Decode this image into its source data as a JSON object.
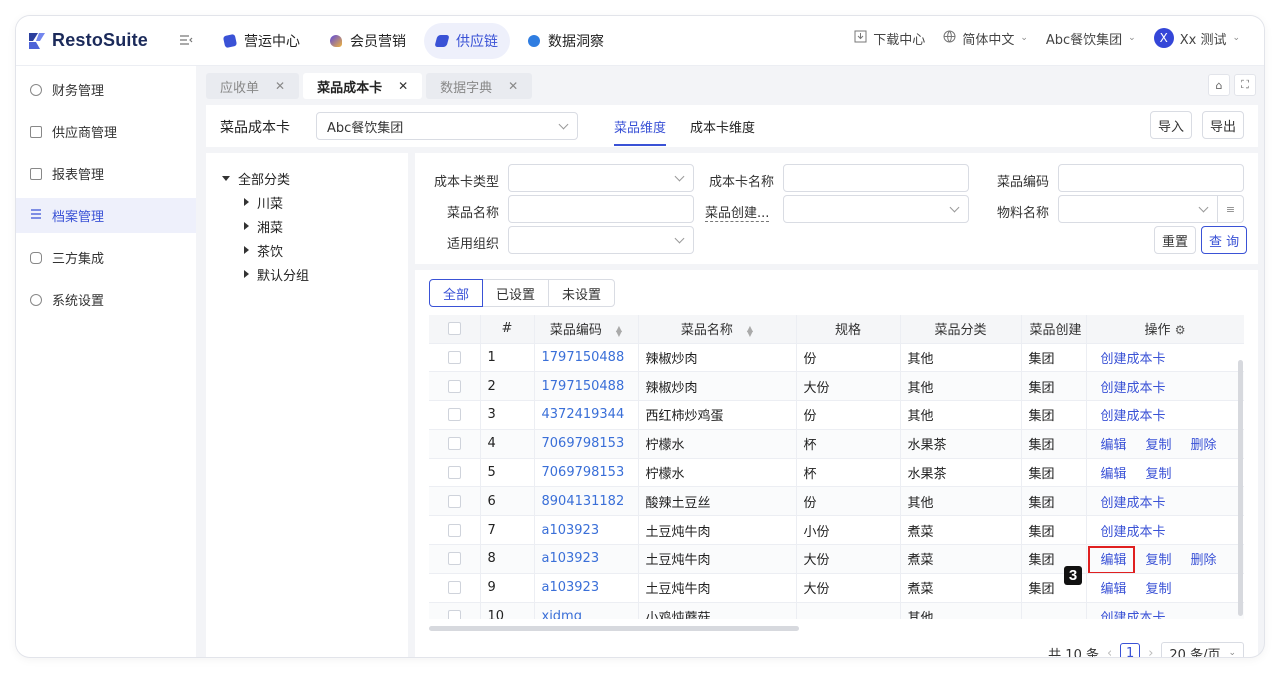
{
  "app": {
    "name": "RestoSuite"
  },
  "top_nav": [
    {
      "label": "营运中心",
      "icon": "ops-icon",
      "color": "#3a52d6"
    },
    {
      "label": "会员营销",
      "icon": "member-icon",
      "color": "#5a48e0"
    },
    {
      "label": "供应链",
      "icon": "supply-icon",
      "color": "#3a52d6",
      "active": true
    },
    {
      "label": "数据洞察",
      "icon": "data-icon",
      "color": "#2f7de1"
    }
  ],
  "top_right": {
    "download": "下载中心",
    "language": "简体中文",
    "org": "Abc餐饮集团",
    "avatar_initial": "X",
    "user": "Xx 测试"
  },
  "sidebar": [
    {
      "label": "财务管理"
    },
    {
      "label": "供应商管理"
    },
    {
      "label": "报表管理"
    },
    {
      "label": "档案管理",
      "active": true
    },
    {
      "label": "三方集成"
    },
    {
      "label": "系统设置"
    }
  ],
  "tabs": [
    {
      "label": "应收单"
    },
    {
      "label": "菜品成本卡",
      "active": true
    },
    {
      "label": "数据字典"
    }
  ],
  "header": {
    "title": "菜品成本卡",
    "org_select": "Abc餐饮集团",
    "dim_tabs": [
      "菜品维度",
      "成本卡维度"
    ],
    "import": "导入",
    "export": "导出"
  },
  "tree": {
    "root": "全部分类",
    "children": [
      "川菜",
      "湘菜",
      "茶饮",
      "默认分组"
    ]
  },
  "filters": {
    "labels": [
      "成本卡类型",
      "成本卡名称",
      "菜品编码",
      "菜品名称",
      "菜品创建...",
      "物料名称",
      "适用组织"
    ],
    "reset": "重置",
    "query": "查 询"
  },
  "segments": [
    "全部",
    "已设置",
    "未设置"
  ],
  "table": {
    "headers": [
      "#",
      "菜品编码",
      "菜品名称",
      "规格",
      "菜品分类",
      "菜品创建",
      "操作"
    ],
    "rows": [
      {
        "n": "1",
        "code": "1797150488",
        "name": "辣椒炒肉",
        "spec": "份",
        "cat": "其他",
        "org": "集团",
        "ops": [
          "创建成本卡"
        ]
      },
      {
        "n": "2",
        "code": "1797150488",
        "name": "辣椒炒肉",
        "spec": "大份",
        "cat": "其他",
        "org": "集团",
        "ops": [
          "创建成本卡"
        ]
      },
      {
        "n": "3",
        "code": "4372419344",
        "name": "西红柿炒鸡蛋",
        "spec": "份",
        "cat": "其他",
        "org": "集团",
        "ops": [
          "创建成本卡"
        ]
      },
      {
        "n": "4",
        "code": "7069798153",
        "name": "柠檬水",
        "spec": "杯",
        "cat": "水果茶",
        "org": "集团",
        "ops": [
          "编辑",
          "复制",
          "删除"
        ]
      },
      {
        "n": "5",
        "code": "7069798153",
        "name": "柠檬水",
        "spec": "杯",
        "cat": "水果茶",
        "org": "集团",
        "ops": [
          "编辑",
          "复制"
        ]
      },
      {
        "n": "6",
        "code": "8904131182",
        "name": "酸辣土豆丝",
        "spec": "份",
        "cat": "其他",
        "org": "集团",
        "ops": [
          "创建成本卡"
        ]
      },
      {
        "n": "7",
        "code": "a103923",
        "name": "土豆炖牛肉",
        "spec": "小份",
        "cat": "煮菜",
        "org": "集团",
        "ops": [
          "创建成本卡"
        ]
      },
      {
        "n": "8",
        "code": "a103923",
        "name": "土豆炖牛肉",
        "spec": "大份",
        "cat": "煮菜",
        "org": "集团",
        "ops": [
          "编辑",
          "复制",
          "删除"
        ],
        "highlight": true
      },
      {
        "n": "9",
        "code": "a103923",
        "name": "土豆炖牛肉",
        "spec": "大份",
        "cat": "煮菜",
        "org": "集团",
        "ops": [
          "编辑",
          "复制"
        ]
      },
      {
        "n": "10",
        "code": "xidmg",
        "name": "小鸡炖蘑菇",
        "spec": "",
        "cat": "其他",
        "org": "",
        "ops": [
          "创建成本卡"
        ]
      }
    ]
  },
  "annotation": {
    "marker": "3"
  },
  "pager": {
    "total": "共 10 条",
    "current": "1",
    "size": "20 条/页"
  },
  "colors": {
    "accent": "#3a52d6",
    "link": "#3a6fd8",
    "highlight": "#e02020"
  }
}
